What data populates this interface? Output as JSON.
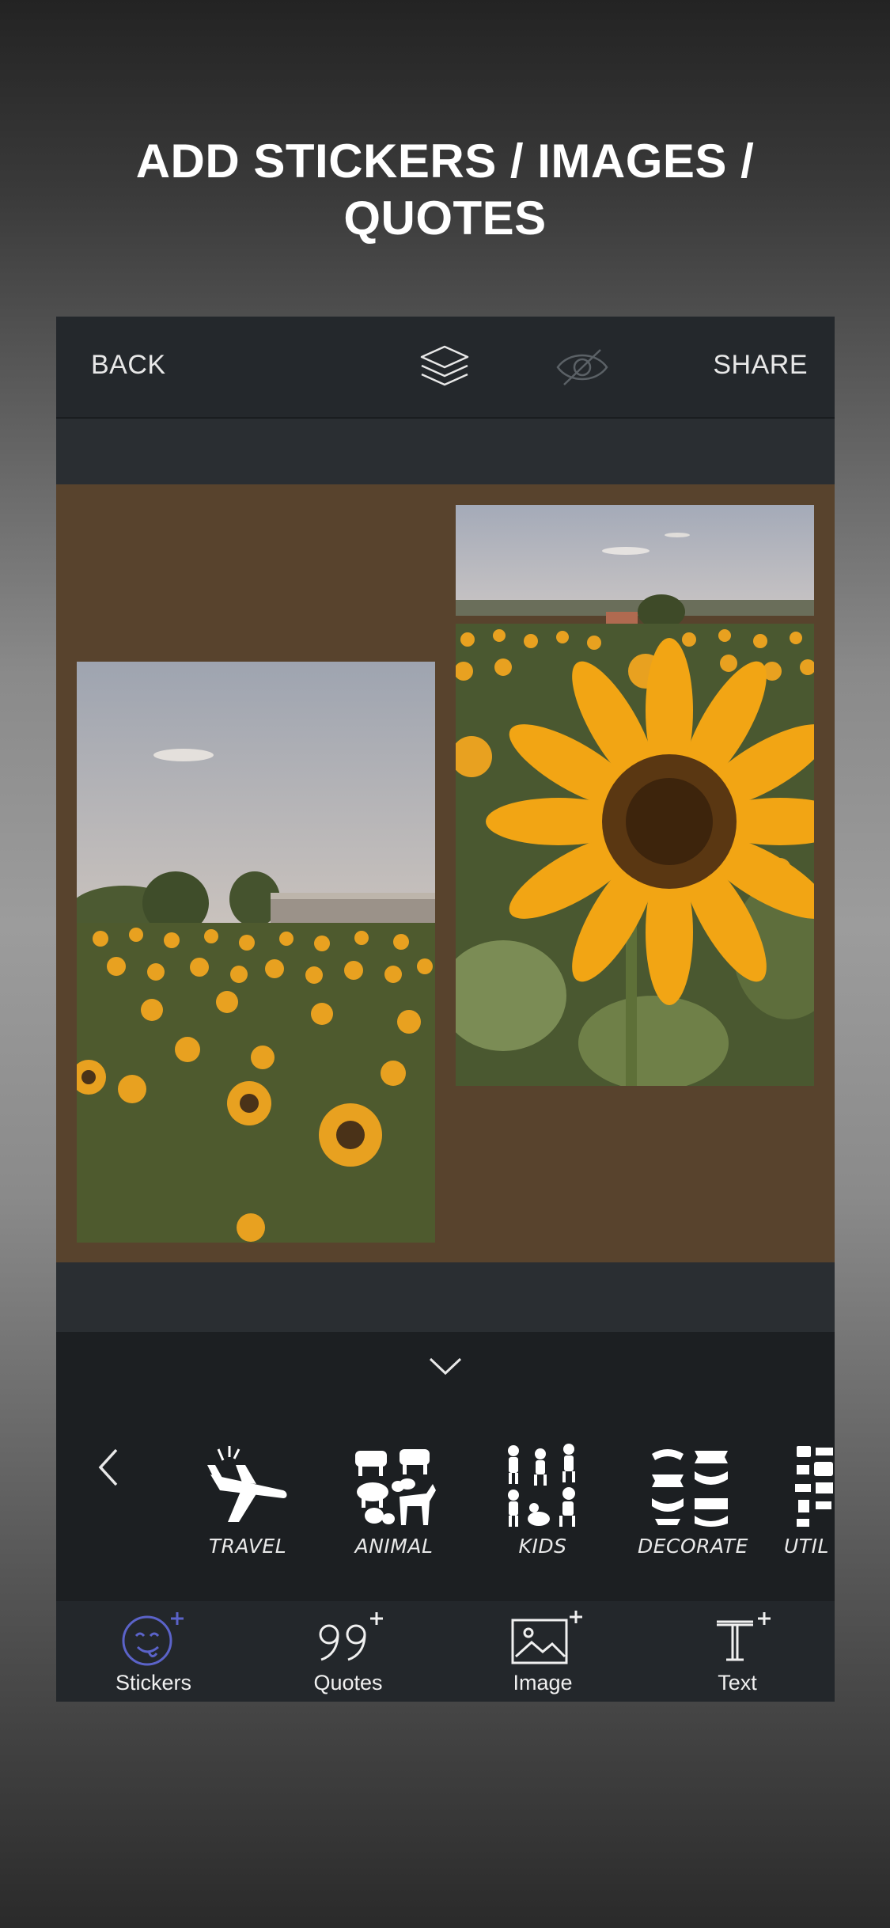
{
  "headline": {
    "line1": "ADD STICKERS / IMAGES /",
    "line2": "QUOTES"
  },
  "topbar": {
    "back_label": "BACK",
    "share_label": "SHARE",
    "layers_icon": "layers-icon",
    "eye_icon": "eye-hidden-icon"
  },
  "canvas": {
    "background": "#58432d",
    "photos": [
      {
        "name": "sunflower-field-photo",
        "description_icon": "photo"
      },
      {
        "name": "sunflower-closeup-photo",
        "description_icon": "photo"
      }
    ]
  },
  "tray": {
    "collapse_icon": "chevron-down-icon",
    "prev_icon": "chevron-left-icon",
    "categories": [
      {
        "label": "TRAVEL",
        "icon": "airplane-icon"
      },
      {
        "label": "ANIMAL",
        "icon": "animals-icon"
      },
      {
        "label": "KIDS",
        "icon": "kids-icon"
      },
      {
        "label": "DECORATE",
        "icon": "banners-icon"
      },
      {
        "label": "UTIL",
        "icon": "utility-icon"
      }
    ]
  },
  "tabs": [
    {
      "label": "Stickers",
      "icon": "sticker-face-icon",
      "active": true,
      "accent": "#5b63c9"
    },
    {
      "label": "Quotes",
      "icon": "quote-marks-icon",
      "active": false
    },
    {
      "label": "Image",
      "icon": "image-icon",
      "active": false
    },
    {
      "label": "Text",
      "icon": "text-icon",
      "active": false
    }
  ],
  "colors": {
    "accent": "#5b63c9",
    "toolbar": "#24282c",
    "tray": "#1c1f22"
  }
}
